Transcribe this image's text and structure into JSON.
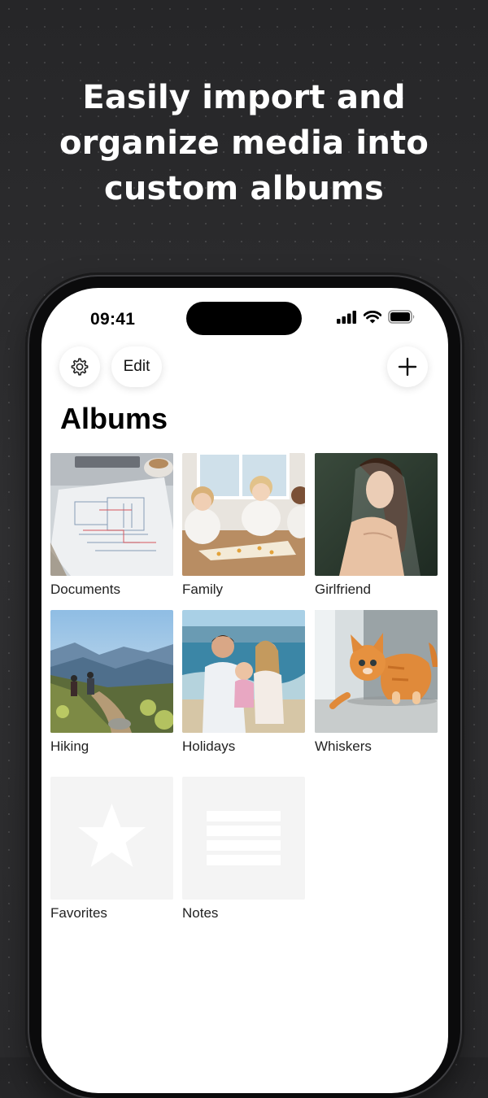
{
  "headline": {
    "line1": "Easily import and",
    "line2": "organize media into",
    "line3": "custom albums"
  },
  "status_bar": {
    "time": "09:41",
    "icons": [
      "cellular-signal-icon",
      "wifi-icon",
      "battery-icon"
    ]
  },
  "toolbar": {
    "settings_icon": "gear-icon",
    "edit_label": "Edit",
    "add_icon": "plus-icon"
  },
  "page": {
    "title": "Albums"
  },
  "albums": [
    {
      "label": "Documents",
      "thumbnail": "photo: architectural blueprint drawings on desk"
    },
    {
      "label": "Family",
      "thumbnail": "photo: children doing a puzzle at table"
    },
    {
      "label": "Girlfriend",
      "thumbnail": "photo: woman portrait with veil"
    },
    {
      "label": "Hiking",
      "thumbnail": "photo: hikers on mountain trail"
    },
    {
      "label": "Holidays",
      "thumbnail": "photo: family at beach"
    },
    {
      "label": "Whiskers",
      "thumbnail": "photo: orange kitten walking"
    },
    {
      "label": "Favorites",
      "thumbnail": "star-icon placeholder"
    },
    {
      "label": "Notes",
      "thumbnail": "text-lines-icon placeholder"
    }
  ],
  "colors": {
    "background": "#2a2a2c",
    "placeholder_tile": "#f4f4f4",
    "placeholder_glyph": "#ffffff"
  }
}
